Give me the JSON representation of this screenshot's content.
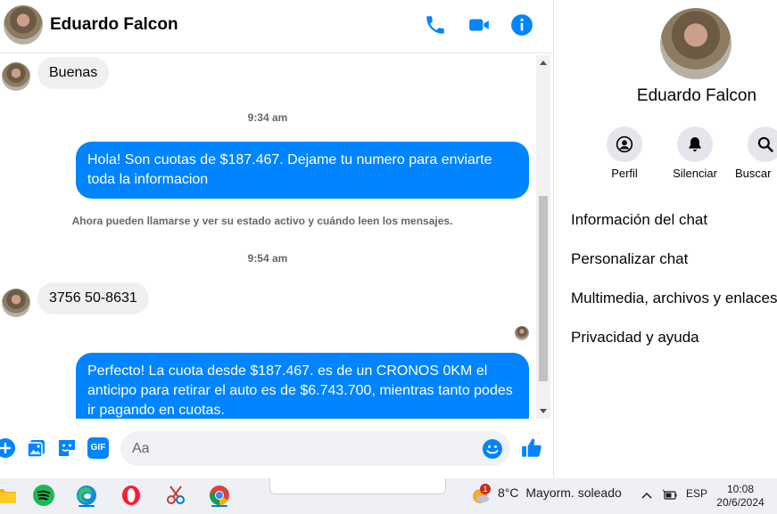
{
  "header": {
    "contact_name": "Eduardo Falcon"
  },
  "messages": {
    "incoming_1": "Buenas",
    "time_1": "9:34 am",
    "outgoing_1": "Hola! Son cuotas de $187.467. Dejame tu numero para enviarte toda la informacion",
    "notice": "Ahora pueden llamarse y ver su estado activo y cuándo leen los mensajes.",
    "time_2": "9:54 am",
    "incoming_2": "3756 50-8631",
    "outgoing_2": "Perfecto! La cuota desde $187.467. es de un CRONOS 0KM el anticipo para retirar el auto es de $6.743.700, mientras tanto podes ir pagando en cuotas."
  },
  "composer": {
    "placeholder": "Aa",
    "gif_label": "GIF"
  },
  "sidebar": {
    "contact_name": "Eduardo Falcon",
    "actions": [
      "Perfil",
      "Silenciar",
      "Buscar"
    ],
    "menu": [
      "Información del chat",
      "Personalizar chat",
      "Multimedia, archivos y enlaces",
      "Privacidad y ayuda"
    ]
  },
  "taskbar": {
    "weather_temp": "8°C",
    "weather_desc": "Mayorm. soleado",
    "weather_badge": "1",
    "language": "ESP",
    "time": "10:08",
    "date": "20/6/2024"
  },
  "colors": {
    "accent": "#0084ff",
    "bubble_in": "#f0f0f0",
    "text": "#050505",
    "muted": "#65676b"
  }
}
